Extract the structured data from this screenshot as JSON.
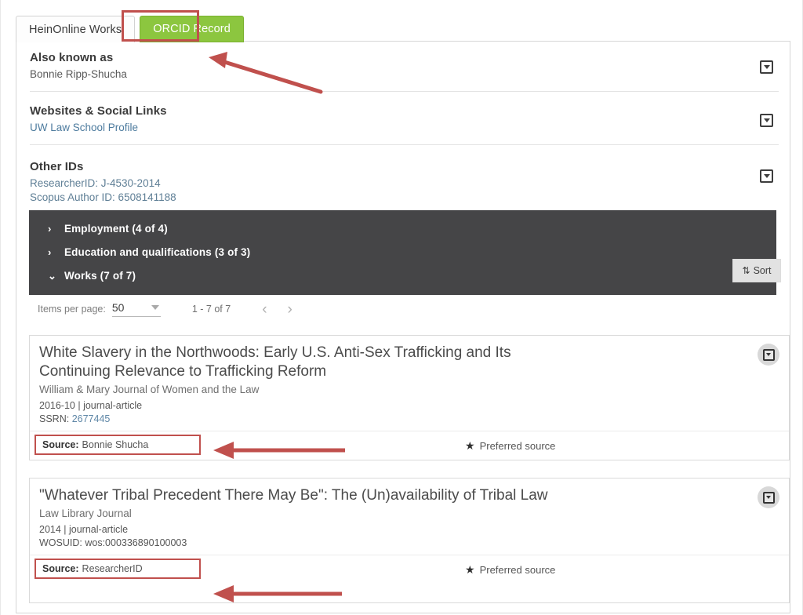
{
  "tabs": [
    {
      "id": "heinonline-works",
      "label": "HeinOnline Works",
      "active": false
    },
    {
      "id": "orcid-record",
      "label": "ORCID Record",
      "active": true
    }
  ],
  "colors": {
    "orcid_tab_green": "#8cc63f",
    "annotation_red": "#c0504d",
    "accordion_dark": "#454547",
    "link_blue": "#5e86a6"
  },
  "sections": [
    {
      "id": "also-known-as",
      "title": "Also known as",
      "lines": [
        "Bonnie Ripp-Shucha"
      ],
      "toggle_icon": "caret-down-box-icon"
    },
    {
      "id": "websites-social-links",
      "title": "Websites & Social Links",
      "lines": [
        "UW Law School Profile"
      ],
      "toggle_icon": "caret-down-box-icon"
    },
    {
      "id": "other-ids",
      "title": "Other IDs",
      "lines": [
        "ResearcherID: J-4530-2014",
        "Scopus Author ID: 6508141188"
      ],
      "toggle_icon": "caret-down-box-icon"
    }
  ],
  "accordion": {
    "rows": [
      {
        "id": "employment",
        "chevron": "›",
        "label": "Employment (4 of 4)",
        "expanded": false
      },
      {
        "id": "education",
        "chevron": "›",
        "label": "Education and qualifications (3 of 3)",
        "expanded": false
      },
      {
        "id": "works",
        "chevron": "⌄",
        "label": "Works (7 of 7)",
        "expanded": true
      }
    ]
  },
  "sort_button": {
    "label": "Sort",
    "icon": "sort-arrows-icon"
  },
  "paginator": {
    "items_per_page_label": "Items per page:",
    "items_per_page_value": "50",
    "range_label": "1 - 7 of 7",
    "prev_icon": "‹",
    "next_icon": "›"
  },
  "works": [
    {
      "id": "work-1",
      "title": "White Slavery in the Northwoods: Early U.S. Anti-Sex Trafficking and Its Continuing Relevance to Trafficking Reform",
      "journal": "William & Mary Journal of Women and the Law",
      "meta": "2016-10 | journal-article",
      "id_label": "SSRN:",
      "id_value": "2677445",
      "source_label": "Source:",
      "source_value": "Bonnie Shucha",
      "preferred_label": "Preferred source",
      "toggle_icon": "caret-down-circle-icon"
    },
    {
      "id": "work-2",
      "title": "\"Whatever Tribal Precedent There May Be\": The (Un)availability of Tribal Law",
      "journal": "Law Library Journal",
      "meta": "2014 | journal-article",
      "id_label": "WOSUID:",
      "id_value": "wos:000336890100003",
      "source_label": "Source:",
      "source_value": "ResearcherID",
      "preferred_label": "Preferred source",
      "toggle_icon": "caret-down-circle-icon"
    }
  ],
  "annotations": {
    "arrow_top": "red-arrow-pointing-to-orcid-tab",
    "arrow_source_1": "red-arrow-pointing-to-source-bonnie-shucha",
    "arrow_source_2": "red-arrow-pointing-to-source-researcherid",
    "box_orcid_tab": "red-box-around-orcid-record-tab",
    "box_source_1": "red-box-around-source-bonnie-shucha",
    "box_source_2": "red-box-around-source-researcherid"
  }
}
